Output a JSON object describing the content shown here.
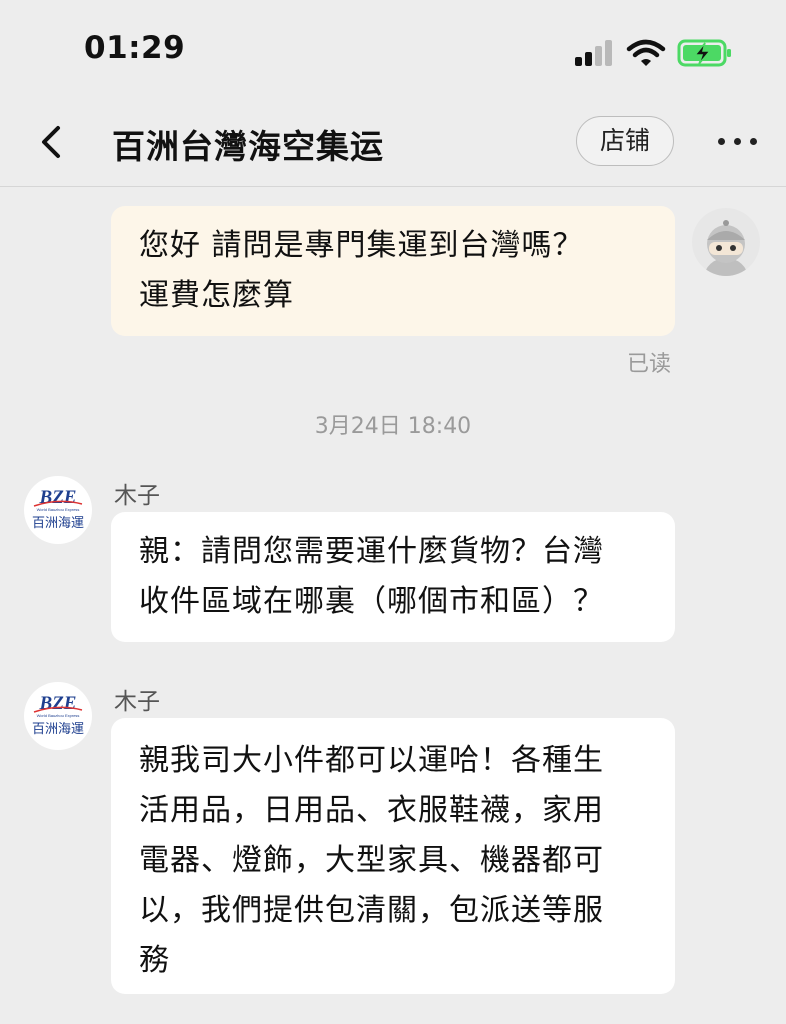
{
  "status_bar": {
    "time": "01:29"
  },
  "header": {
    "title": "百洲台灣海空集运",
    "store_label": "店铺"
  },
  "chat": {
    "outgoing": {
      "lines": [
        "您好 請問是專門集運到台灣嗎？",
        "運費怎麼算"
      ],
      "read_status": "已读"
    },
    "timestamp": "3月24日 18:40",
    "incoming": [
      {
        "sender": "木子",
        "avatar_logo": "BZE",
        "avatar_subtitle": "World Bauzhou Express",
        "avatar_name": "百洲海運",
        "lines": [
          "親：請問您需要運什麼貨物？台灣",
          "收件區域在哪裏（哪個市和區）？"
        ]
      },
      {
        "sender": "木子",
        "avatar_logo": "BZE",
        "avatar_subtitle": "World Bauzhou Express",
        "avatar_name": "百洲海運",
        "lines": [
          "親我司大小件都可以運哈！各種生",
          "活用品，日用品、衣服鞋襪，家用",
          "電器、燈飾，大型家具、機器都可",
          "以，我們提供包清關，包派送等服",
          "務"
        ]
      }
    ]
  },
  "colors": {
    "background": "#ededed",
    "outgoing_bubble": "#fdf6e9",
    "incoming_bubble": "#ffffff",
    "battery_green": "#4cd964",
    "muted_text": "#9a9a9a",
    "logo_blue": "#1e3f8f"
  },
  "icons": [
    "signal-icon",
    "wifi-icon",
    "battery-charging-icon",
    "back-chevron-icon",
    "more-dots-icon",
    "user-avatar-icon"
  ]
}
